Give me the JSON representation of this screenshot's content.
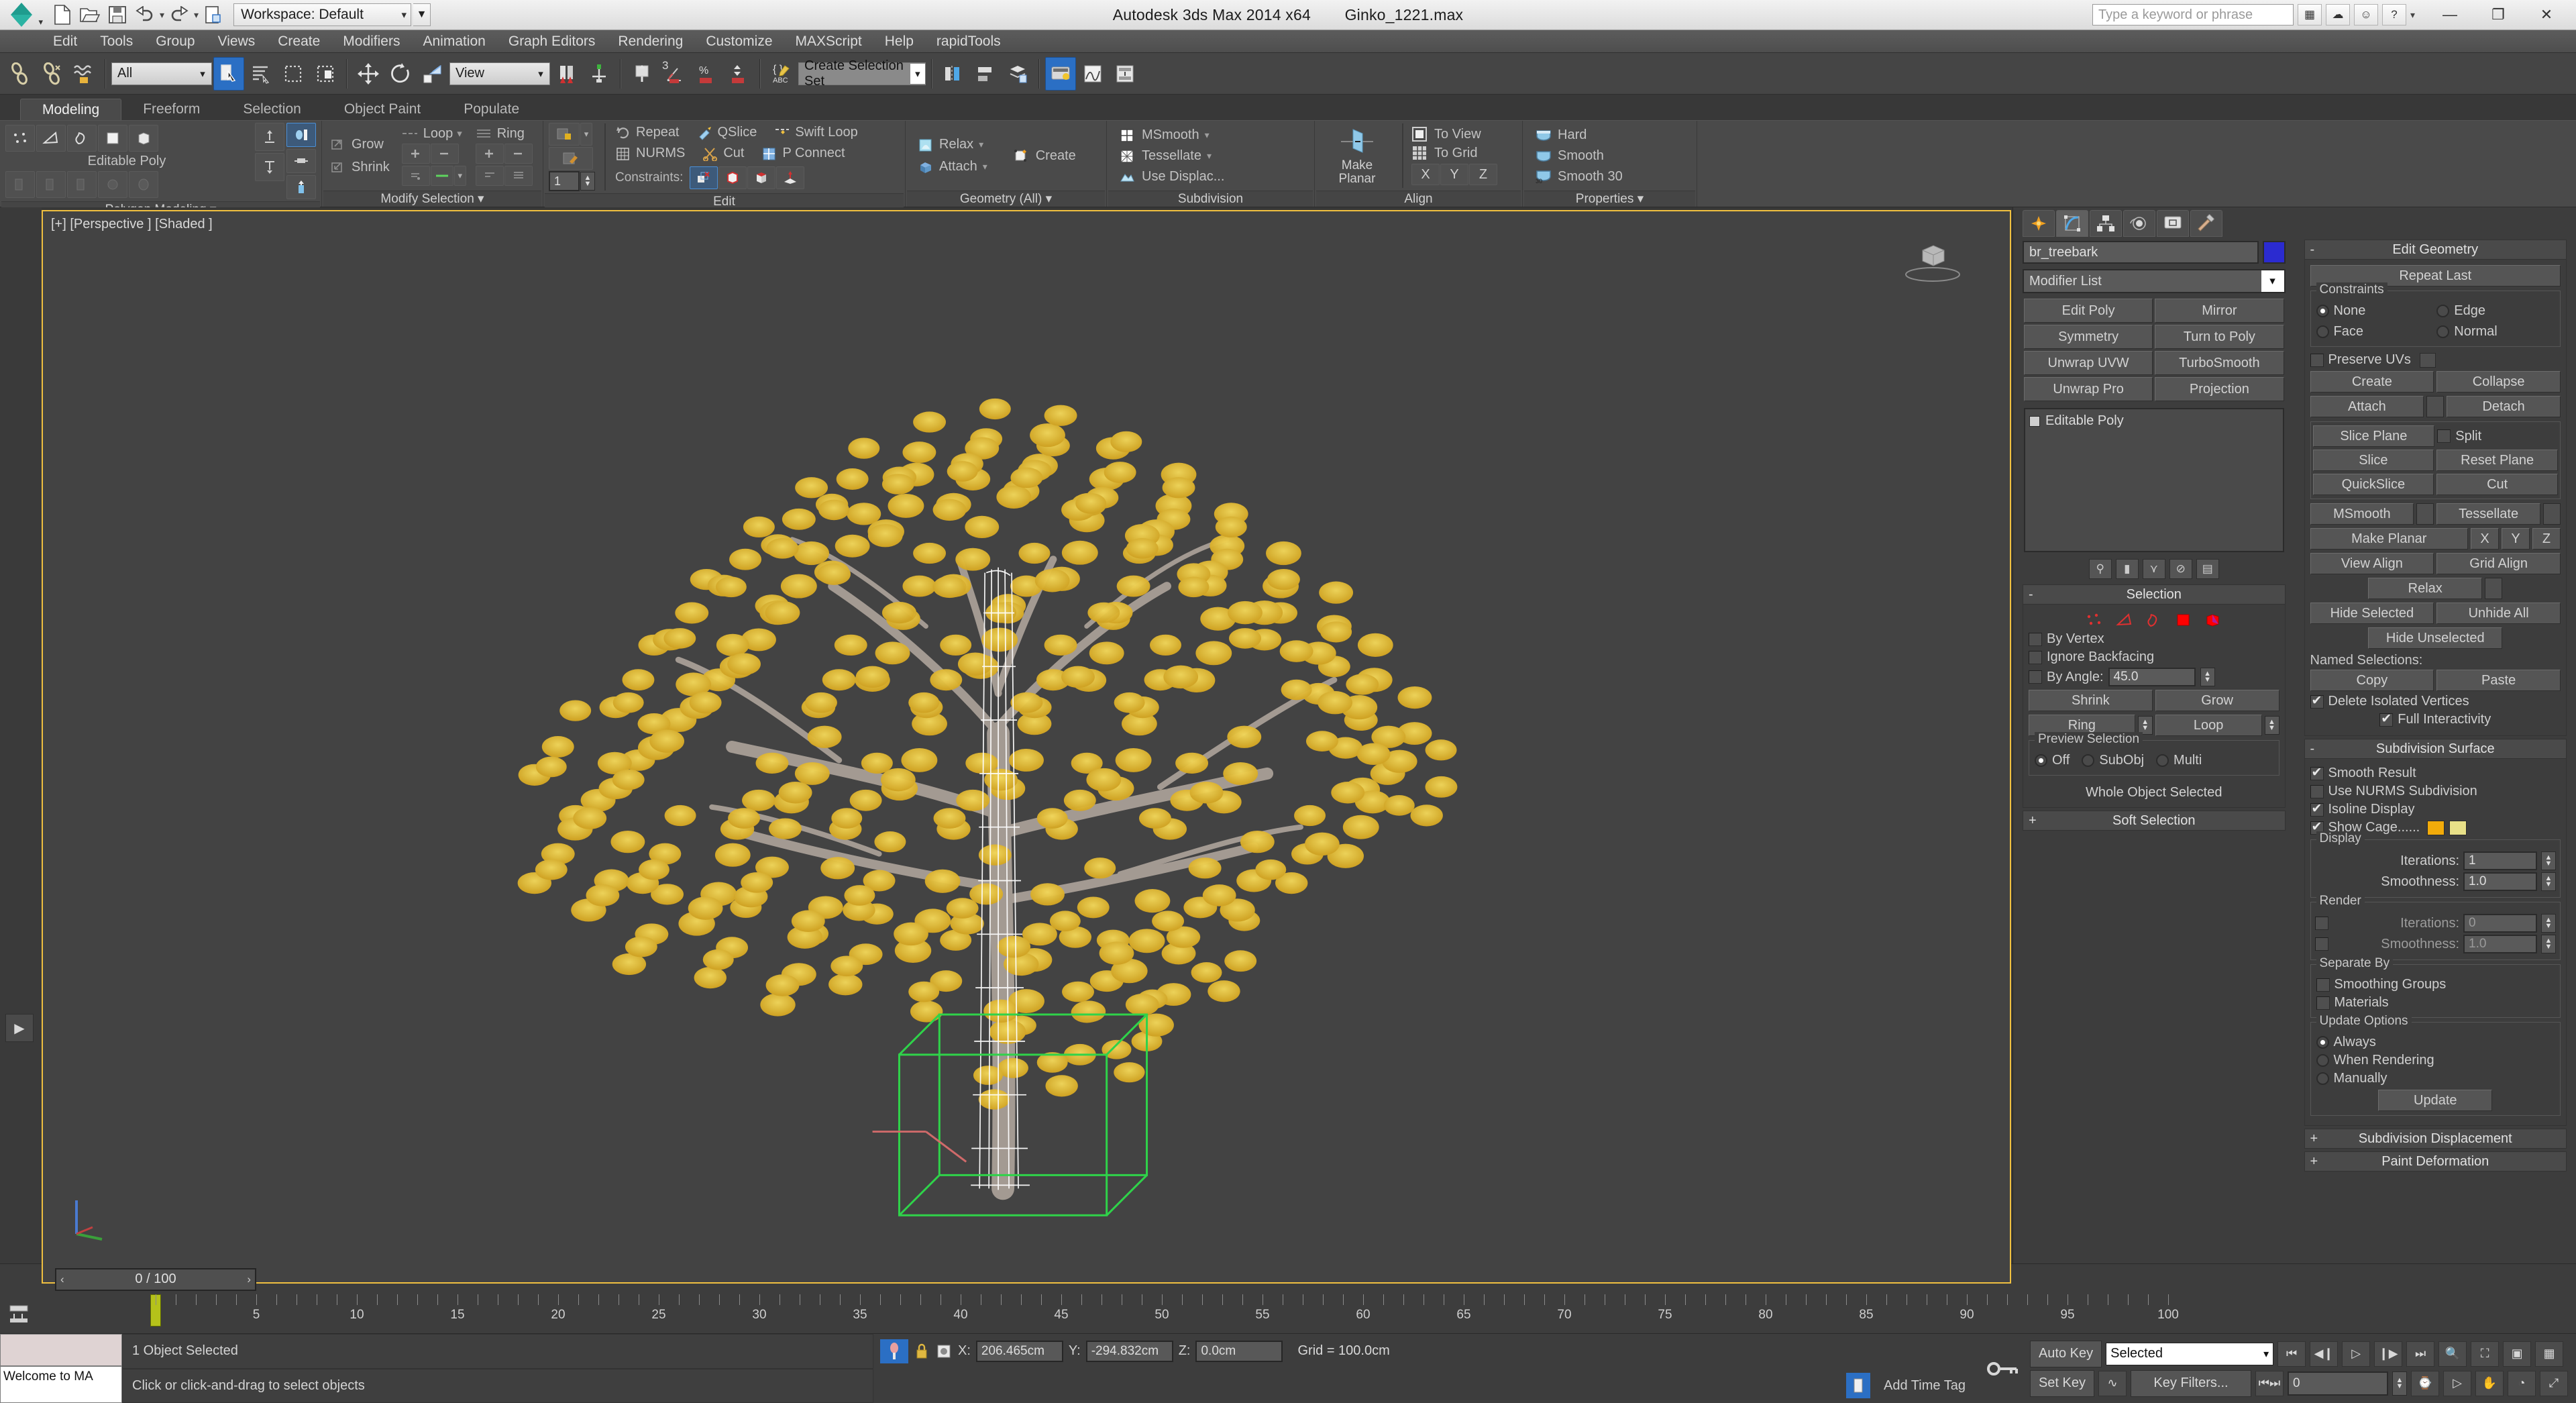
{
  "title_bar": {
    "app_title": "Autodesk 3ds Max  2014 x64",
    "file_name": "Ginko_1221.max",
    "workspace_label": "Workspace: Default",
    "search_placeholder": "Type a keyword or phrase",
    "quick_access": [
      {
        "name": "new-file-icon",
        "label": "New"
      },
      {
        "name": "open-file-icon",
        "label": "Open"
      },
      {
        "name": "save-file-icon",
        "label": "Save"
      },
      {
        "name": "undo-icon",
        "label": "Undo"
      },
      {
        "name": "redo-icon",
        "label": "Redo"
      },
      {
        "name": "project-folder-icon",
        "label": "Set Project Folder"
      }
    ],
    "window_buttons": [
      "minimize",
      "maximize",
      "close"
    ]
  },
  "menu_bar": {
    "items": [
      "Edit",
      "Tools",
      "Group",
      "Views",
      "Create",
      "Modifiers",
      "Animation",
      "Graph Editors",
      "Rendering",
      "Customize",
      "MAXScript",
      "Help",
      "rapidTools"
    ]
  },
  "main_toolbar": {
    "selection_filter": "All",
    "reference_coordinate_system": "View",
    "named_selection_sets": "Create Selection Set",
    "angle_snap_value": "3",
    "buttons": [
      {
        "name": "select-and-link-icon"
      },
      {
        "name": "unlink-selection-icon"
      },
      {
        "name": "bind-to-space-warp-icon"
      },
      {
        "name": "select-object-icon",
        "active": true
      },
      {
        "name": "select-by-name-icon"
      },
      {
        "name": "rectangular-selection-region-icon"
      },
      {
        "name": "window-crossing-icon"
      },
      {
        "name": "select-and-move-icon"
      },
      {
        "name": "select-and-rotate-icon"
      },
      {
        "name": "select-and-scale-icon"
      },
      {
        "name": "use-pivot-point-center-icon"
      },
      {
        "name": "select-and-manipulate-icon"
      },
      {
        "name": "snaps-toggle-icon"
      },
      {
        "name": "angle-snap-toggle-icon"
      },
      {
        "name": "percent-snap-toggle-icon"
      },
      {
        "name": "spinner-snap-toggle-icon"
      },
      {
        "name": "edit-named-selection-sets-icon"
      },
      {
        "name": "mirror-icon"
      },
      {
        "name": "align-icon"
      },
      {
        "name": "layer-manager-icon"
      },
      {
        "name": "material-editor-icon",
        "active": true
      },
      {
        "name": "curve-editor-icon"
      },
      {
        "name": "schematic-view-icon"
      }
    ]
  },
  "ribbon": {
    "tabs": [
      {
        "label": "Modeling",
        "active": true
      },
      {
        "label": "Freeform",
        "active": false
      },
      {
        "label": "Selection",
        "active": false
      },
      {
        "label": "Object Paint",
        "active": false
      },
      {
        "label": "Populate",
        "active": false
      }
    ],
    "panels": [
      {
        "title": "Polygon Modeling",
        "object_type": "Editable Poly",
        "subobject_icons": [
          "vertex-icon",
          "edge-icon",
          "border-icon",
          "polygon-icon",
          "element-icon"
        ],
        "tool_icons": [
          "generate-topology-icon",
          "symmetry-tools-icon",
          "paint-deform-icon",
          "preserve-uv-icon",
          "soft-selection-icon"
        ]
      },
      {
        "title": "Modify Selection",
        "grow_label": "Grow",
        "shrink_label": "Shrink",
        "loop_label": "Loop",
        "ring_label": "Ring"
      },
      {
        "title": "Edit",
        "repeat_label": "Repeat",
        "nurms_label": "NURMS",
        "qslice_label": "QSlice",
        "cut_label": "Cut",
        "swift_loop_label": "Swift Loop",
        "p_connect_label": "P Connect",
        "constraints_label": "Constraints:",
        "constraint_options": [
          "none-constraint-icon",
          "edge-constraint-icon",
          "face-constraint-icon",
          "normal-constraint-icon"
        ],
        "iteration_value": "1"
      },
      {
        "title": "Geometry (All)",
        "relax_label": "Relax",
        "attach_label": "Attach",
        "create_label": "Create"
      },
      {
        "title": "Subdivision",
        "msmooth_label": "MSmooth",
        "tessellate_label": "Tessellate",
        "use_displacement_label": "Use Displac..."
      },
      {
        "title": "Align",
        "make_planar_label": "Make\nPlanar",
        "make_planar_line1": "Make",
        "make_planar_line2": "Planar",
        "to_view_label": "To View",
        "to_grid_label": "To Grid",
        "axis_x": "X",
        "axis_y": "Y",
        "axis_z": "Z"
      },
      {
        "title": "Properties",
        "hard_label": "Hard",
        "smooth_label": "Smooth",
        "smooth30_label": "Smooth 30"
      }
    ]
  },
  "viewport": {
    "label": "[+] [Perspective ] [Shaded ]",
    "scene": "ginkgo tree with yellow autumn foliage, white wireframe trunk, green selection bounding box",
    "border_color": "#f0c040"
  },
  "command_panel": {
    "tabs": [
      {
        "name": "create-tab-icon",
        "label": "Create",
        "active": false
      },
      {
        "name": "modify-tab-icon",
        "label": "Modify",
        "active": true
      },
      {
        "name": "hierarchy-tab-icon",
        "label": "Hierarchy",
        "active": false
      },
      {
        "name": "motion-tab-icon",
        "label": "Motion",
        "active": false
      },
      {
        "name": "display-tab-icon",
        "label": "Display",
        "active": false
      },
      {
        "name": "utilities-tab-icon",
        "label": "Utilities",
        "active": false
      }
    ],
    "object_name": "br_treebark",
    "object_color": "#2b2bd0",
    "modifier_list_label": "Modifier List",
    "modifier_buttons": [
      "Edit Poly",
      "Mirror",
      "Symmetry",
      "Turn to Poly",
      "Unwrap UVW",
      "TurboSmooth",
      "Unwrap Pro",
      "Projection"
    ],
    "modifier_stack": [
      "Editable Poly"
    ],
    "stack_tools": [
      "pin-stack-icon",
      "show-end-result-icon",
      "make-unique-icon",
      "remove-modifier-icon",
      "configure-sets-icon"
    ],
    "selection_rollout": {
      "title": "Selection",
      "subobject_levels": [
        "vertex-level-icon",
        "edge-level-icon",
        "border-level-icon",
        "polygon-level-icon",
        "element-level-icon"
      ],
      "by_vertex": {
        "label": "By Vertex",
        "checked": false
      },
      "ignore_backfacing": {
        "label": "Ignore Backfacing",
        "checked": false
      },
      "by_angle": {
        "label": "By Angle:",
        "checked": false,
        "value": "45.0"
      },
      "shrink_label": "Shrink",
      "grow_label": "Grow",
      "ring_label": "Ring",
      "loop_label": "Loop",
      "preview_selection_label": "Preview Selection",
      "preview_options": [
        {
          "label": "Off",
          "selected": true
        },
        {
          "label": "SubObj",
          "selected": false
        },
        {
          "label": "Multi",
          "selected": false
        }
      ],
      "status": "Whole Object Selected"
    },
    "soft_selection_rollout": {
      "title": "Soft Selection"
    },
    "edit_geometry_rollout": {
      "title": "Edit Geometry",
      "repeat_last": "Repeat Last",
      "constraints_group": "Constraints",
      "constraints": [
        {
          "label": "None",
          "selected": true
        },
        {
          "label": "Edge",
          "selected": false
        },
        {
          "label": "Face",
          "selected": false
        },
        {
          "label": "Normal",
          "selected": false
        }
      ],
      "preserve_uvs": {
        "label": "Preserve UVs",
        "checked": false
      },
      "buttons": [
        "Create",
        "Collapse",
        "Attach",
        "Detach",
        "Slice Plane",
        "Split",
        "Slice",
        "Reset Plane",
        "QuickSlice",
        "Cut",
        "MSmooth",
        "Tessellate"
      ],
      "split_label": "Split",
      "make_planar": "Make Planar",
      "axis_x": "X",
      "axis_y": "Y",
      "axis_z": "Z",
      "view_align": "View Align",
      "grid_align": "Grid Align",
      "relax": "Relax",
      "hide_selected": "Hide Selected",
      "unhide_all": "Unhide All",
      "hide_unselected": "Hide Unselected",
      "named_selections": "Named Selections:",
      "copy": "Copy",
      "paste": "Paste",
      "delete_isolated_vertices": {
        "label": "Delete Isolated Vertices",
        "checked": true
      },
      "full_interactivity": {
        "label": "Full Interactivity",
        "checked": true
      }
    },
    "subdivision_surface_rollout": {
      "title": "Subdivision Surface",
      "smooth_result": {
        "label": "Smooth Result",
        "checked": true
      },
      "use_nurms": {
        "label": "Use NURMS Subdivision",
        "checked": false
      },
      "isoline_display": {
        "label": "Isoline Display",
        "checked": true
      },
      "show_cage": {
        "label": "Show Cage......",
        "checked": true,
        "color1": "#f2ab0a",
        "color2": "#e8e088"
      },
      "display_group": "Display",
      "display_iterations": {
        "label": "Iterations:",
        "value": "1",
        "checked": null
      },
      "display_smoothness": {
        "label": "Smoothness:",
        "value": "1.0"
      },
      "render_group": "Render",
      "render_iterations": {
        "label": "Iterations:",
        "value": "0",
        "checked": false
      },
      "render_smoothness": {
        "label": "Smoothness:",
        "value": "1.0",
        "checked": false
      },
      "separate_by_group": "Separate By",
      "smoothing_groups": {
        "label": "Smoothing Groups",
        "checked": false
      },
      "materials": {
        "label": "Materials",
        "checked": false
      },
      "update_options_group": "Update Options",
      "update_options": [
        {
          "label": "Always",
          "selected": true
        },
        {
          "label": "When Rendering",
          "selected": false
        },
        {
          "label": "Manually",
          "selected": false
        }
      ],
      "update_button": "Update"
    },
    "collapsed_rollouts": [
      "Subdivision Displacement",
      "Paint Deformation"
    ]
  },
  "time_slider": {
    "current_frame_label": "0 / 100",
    "prev_arrow": "‹",
    "next_arrow": "›",
    "ruler_ticks": [
      "5",
      "10",
      "15",
      "20",
      "25",
      "30",
      "35",
      "40",
      "45",
      "50",
      "55",
      "60",
      "65",
      "70",
      "75",
      "80",
      "85",
      "90",
      "95",
      "100"
    ],
    "range_start": 0,
    "range_end": 100
  },
  "status_bar": {
    "maxscript_listener": "Welcome to MA",
    "selection_status": "1 Object Selected",
    "prompt": "Click or click-and-drag to select objects",
    "coordinates": {
      "x_label": "X:",
      "x_value": "206.465cm",
      "y_label": "Y:",
      "y_value": "-294.832cm",
      "z_label": "Z:",
      "z_value": "0.0cm"
    },
    "grid_label": "Grid = 100.0cm",
    "add_time_tag": "Add Time Tag",
    "auto_key": "Auto Key",
    "set_key": "Set Key",
    "key_filters": "Key Filters...",
    "key_mode_selection": "Selected",
    "current_time_field": "0",
    "playback_buttons": [
      "go-to-start-icon",
      "previous-frame-icon",
      "play-animation-icon",
      "next-frame-icon",
      "go-to-end-icon"
    ],
    "nav_buttons": [
      "zoom-icon",
      "zoom-all-icon",
      "zoom-extents-icon",
      "zoom-extents-all-icon",
      "field-of-view-icon",
      "maximize-viewport-icon",
      "pan-view-icon",
      "orbit-icon",
      "maximize-toggle-icon"
    ]
  }
}
